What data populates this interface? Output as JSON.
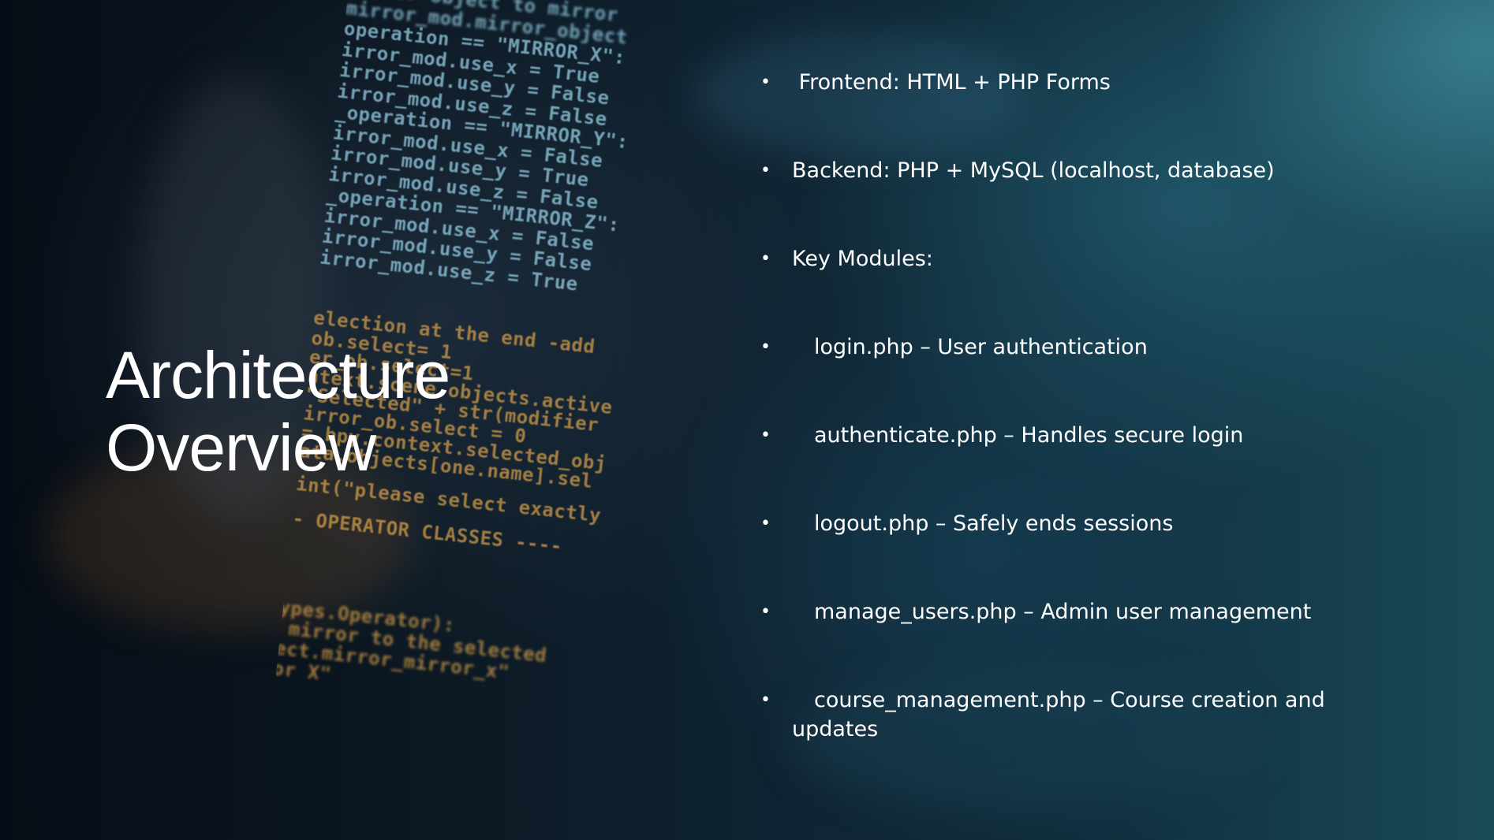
{
  "slide": {
    "title_line1": "Architecture",
    "title_line2": "Overview"
  },
  "bullets": [
    {
      "text": " Frontend: HTML + PHP Forms",
      "indent": false
    },
    {
      "text": "Backend: PHP + MySQL (localhost, database)",
      "indent": false
    },
    {
      "text": "Key Modules:",
      "indent": false
    },
    {
      "text": "login.php – User authentication",
      "indent": true
    },
    {
      "text": "authenticate.php – Handles secure login",
      "indent": true
    },
    {
      "text": "logout.php – Safely ends sessions",
      "indent": true
    },
    {
      "text": "manage_users.php – Admin user management",
      "indent": true
    },
    {
      "text": "course_management.php – Course creation and updates",
      "indent": true
    }
  ],
  "bullet_symbol": "•",
  "background_code": {
    "lines_blue": [
      "r or object to mirror",
      "mirror_mod.mirror_object",
      "operation == \"MIRROR_X\":",
      "irror_mod.use_x = True",
      "irror_mod.use_y = False",
      "irror_mod.use_z = False",
      "_operation == \"MIRROR_Y\":",
      "irror_mod.use_x = False",
      "irror_mod.use_y = True",
      "irror_mod.use_z = False",
      "_operation == \"MIRROR_Z\":",
      "irror_mod.use_x = False",
      "irror_mod.use_y = False",
      "irror_mod.use_z = True"
    ],
    "lines_orange": [
      "election at the end -add",
      "ob.select= 1",
      "er_ob.select=1",
      "ntext.scene.objects.active",
      "\"Selected\" + str(modifier",
      "irror_ob.select = 0",
      "= bpy.context.selected_obj",
      "ata.objects[one.name].sel",
      "int(\"please select exactly",
      "- OPERATOR CLASSES ----",
      "types.Operator):",
      "X mirror to the selected",
      "ject.mirror_mirror_x\"",
      "ror X\""
    ]
  },
  "colors": {
    "text": "#ffffff",
    "code_blue": "#8fc6dc",
    "code_orange": "#d7a04a",
    "bg_dark": "#06101c",
    "bg_teal": "#1a4a58"
  }
}
